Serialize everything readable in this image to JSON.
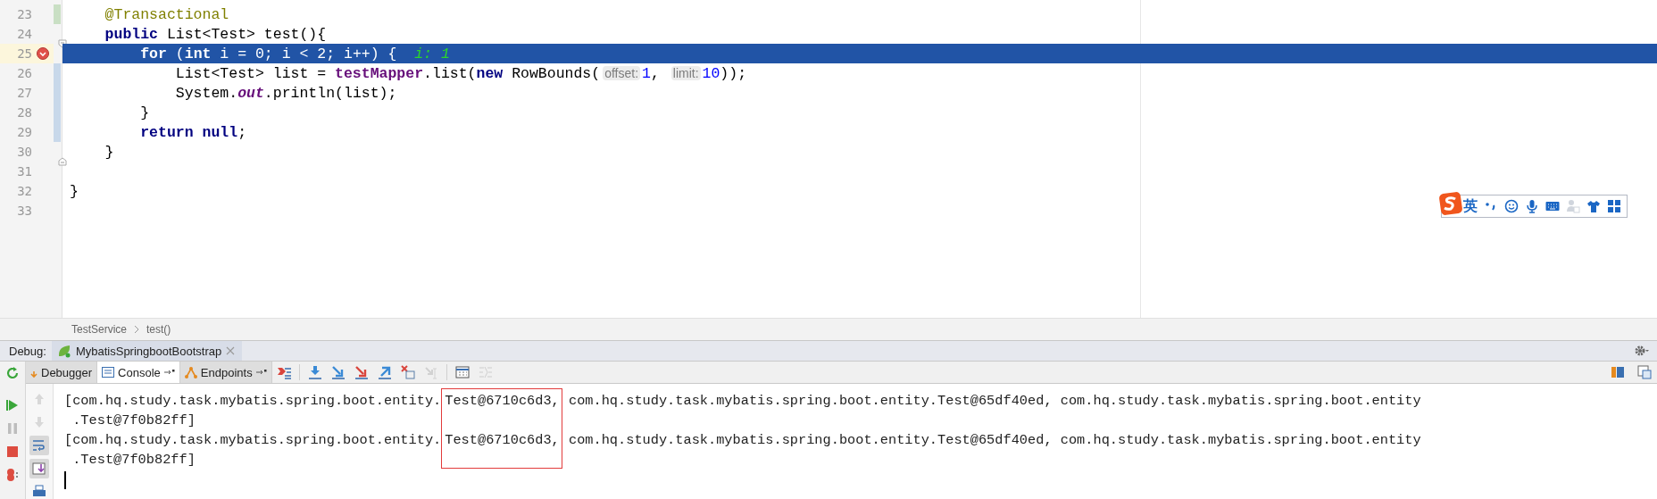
{
  "editor": {
    "lines": [
      {
        "number": "23",
        "current": false,
        "breakpoint": false,
        "change": {
          "color": "#c9dfc4"
        },
        "tokens": [
          {
            "kind": "annotation",
            "text": "    @Transactional"
          }
        ]
      },
      {
        "number": "24",
        "current": false,
        "breakpoint": false,
        "fold": {
          "kind": "start"
        },
        "tokens": [
          {
            "kind": "keyword",
            "text": "    public"
          },
          {
            "kind": "plain",
            "text": " List<Test> test(){"
          }
        ]
      },
      {
        "number": "25",
        "current": true,
        "breakpoint": true,
        "tokens": [
          {
            "kind": "keyword",
            "text": "        for"
          },
          {
            "kind": "plain",
            "text": " ("
          },
          {
            "kind": "keyword",
            "text": "int"
          },
          {
            "kind": "plain",
            "text": " i = 0; i < 2; i++) {  "
          },
          {
            "kind": "inlay",
            "text": "i: 1"
          }
        ]
      },
      {
        "number": "26",
        "current": false,
        "breakpoint": false,
        "change": {
          "color": "#c8d8ea"
        },
        "tokens": [
          {
            "kind": "plain",
            "text": "            List<Test> list = "
          },
          {
            "kind": "field",
            "text": "testMapper"
          },
          {
            "kind": "plain",
            "text": ".list("
          },
          {
            "kind": "keyword",
            "text": "new"
          },
          {
            "kind": "plain",
            "text": " RowBounds("
          },
          {
            "kind": "hint",
            "text": "offset:"
          },
          {
            "kind": "number",
            "text": "1"
          },
          {
            "kind": "plain",
            "text": ", "
          },
          {
            "kind": "hint",
            "text": "limit:"
          },
          {
            "kind": "number",
            "text": "10"
          },
          {
            "kind": "plain",
            "text": "));"
          }
        ]
      },
      {
        "number": "27",
        "current": false,
        "breakpoint": false,
        "change": {
          "color": "#c8d8ea"
        },
        "tokens": [
          {
            "kind": "plain",
            "text": "            System."
          },
          {
            "kind": "static",
            "text": "out"
          },
          {
            "kind": "plain",
            "text": ".println(list);"
          }
        ]
      },
      {
        "number": "28",
        "current": false,
        "breakpoint": false,
        "change": {
          "color": "#c8d8ea"
        },
        "tokens": [
          {
            "kind": "plain",
            "text": "        }"
          }
        ]
      },
      {
        "number": "29",
        "current": false,
        "breakpoint": false,
        "change": {
          "color": "#c8d8ea"
        },
        "tokens": [
          {
            "kind": "keyword",
            "text": "        return null"
          },
          {
            "kind": "plain",
            "text": ";"
          }
        ]
      },
      {
        "number": "30",
        "current": false,
        "breakpoint": false,
        "fold": {
          "kind": "end"
        },
        "tokens": [
          {
            "kind": "plain",
            "text": "    }"
          }
        ]
      },
      {
        "number": "31",
        "current": false,
        "breakpoint": false
      },
      {
        "number": "32",
        "current": false,
        "breakpoint": false,
        "tokens": [
          {
            "kind": "plain",
            "text": "}"
          }
        ]
      },
      {
        "number": "33",
        "current": false,
        "breakpoint": false
      }
    ]
  },
  "ime_toolbar": {
    "language": "英",
    "items": [
      {
        "kind": "punctuation",
        "disabled": false
      },
      {
        "kind": "smiley",
        "disabled": false
      },
      {
        "kind": "microphone",
        "disabled": false
      },
      {
        "kind": "keyboard",
        "disabled": false
      },
      {
        "kind": "person",
        "disabled": true
      },
      {
        "kind": "shirt",
        "disabled": false
      },
      {
        "kind": "grid",
        "disabled": false
      }
    ]
  },
  "breadcrumb": [
    "TestService",
    "test()"
  ],
  "debug": {
    "label": "Debug:",
    "session": {
      "title": "MybatisSpringbootBootstrap",
      "closable": true
    }
  },
  "tool_tabs": [
    {
      "label": "Debugger",
      "selected": false,
      "pinned": false
    },
    {
      "label": "Console",
      "selected": true,
      "pinned": true
    },
    {
      "label": "Endpoints",
      "selected": false,
      "pinned": true
    }
  ],
  "toolbar": [
    {
      "kind": "execution-point",
      "disabled": false
    },
    {
      "kind": "separator"
    },
    {
      "kind": "step-over",
      "disabled": false
    },
    {
      "kind": "step-into",
      "disabled": false
    },
    {
      "kind": "force-step-into",
      "disabled": false
    },
    {
      "kind": "step-out",
      "disabled": false
    },
    {
      "kind": "drop-frame",
      "disabled": false
    },
    {
      "kind": "run-to-cursor",
      "disabled": true
    },
    {
      "kind": "separator"
    },
    {
      "kind": "evaluate",
      "disabled": false
    },
    {
      "kind": "trace",
      "disabled": true
    }
  ],
  "side_actions": [
    {
      "kind": "resume"
    },
    {
      "kind": "pause"
    },
    {
      "kind": "stop"
    },
    {
      "kind": "breakpoints"
    }
  ],
  "console_actions": [
    {
      "kind": "up",
      "disabled": true,
      "selected": false
    },
    {
      "kind": "down",
      "disabled": true,
      "selected": false
    },
    {
      "kind": "wrap",
      "disabled": false,
      "selected": true
    },
    {
      "kind": "scroll-end",
      "disabled": false,
      "selected": true
    },
    {
      "kind": "print",
      "disabled": false,
      "selected": false
    }
  ],
  "console": {
    "lines": [
      {
        "segments": [
          {
            "text": "[com.hq.study.task.mybatis.spring.boot.entity.",
            "boxed": false
          },
          {
            "text": "Test@6710c6d3,",
            "boxed": true
          },
          {
            "text": " com.hq.study.task.mybatis.spring.boot.entity.Test@65df40ed, com.hq.study.task.mybatis.spring.boot.entity",
            "boxed": false
          }
        ]
      },
      {
        "segments": [
          {
            "text": " .Test@7f0b82ff]",
            "boxed": false
          }
        ]
      },
      {
        "segments": [
          {
            "text": "[com.hq.study.task.mybatis.spring.boot.entity.",
            "boxed": false
          },
          {
            "text": "Test@6710c6d3,",
            "boxed": true
          },
          {
            "text": " com.hq.study.task.mybatis.spring.boot.entity.Test@65df40ed, com.hq.study.task.mybatis.spring.boot.entity",
            "boxed": false
          }
        ]
      },
      {
        "segments": [
          {
            "text": " .Test@7f0b82ff]",
            "boxed": false
          }
        ]
      }
    ],
    "cursor": true
  }
}
